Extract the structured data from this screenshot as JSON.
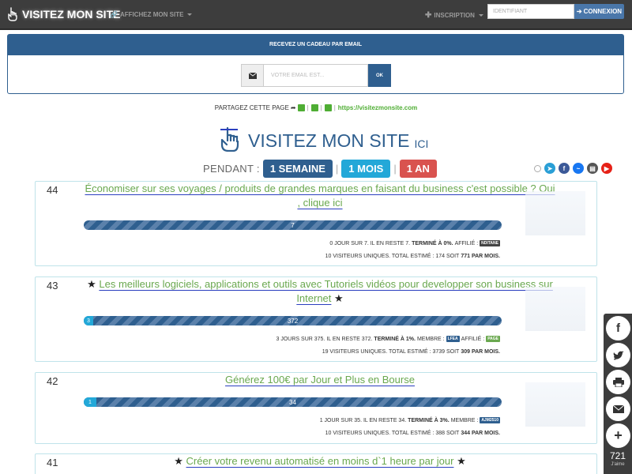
{
  "navbar": {
    "brand": "VISITEZ MON SITE",
    "link_afficher": "AFFICHEZ MON SITE",
    "link_inscription": "INSCRIPTION",
    "login_placeholder": "IDENTIFIANT",
    "login_button": "CONNEXION"
  },
  "gift": {
    "heading": "RECEVEZ UN CADEAU PAR EMAIL",
    "email_placeholder": "VOTRE EMAIL EST...",
    "submit": "OK"
  },
  "share": {
    "label": "PARTAGEZ CETTE PAGE",
    "url": "https://visitezmonsite.com"
  },
  "title": {
    "main": "VISITEZ MON SITE",
    "suffix": "ICI"
  },
  "period": {
    "label": "PENDANT :",
    "week": "1 SEMAINE",
    "month": "1 MOIS",
    "year": "1 AN",
    "separator": "|"
  },
  "items": [
    {
      "num": "44",
      "title": "Économiser sur ses voyages / produits de grandes marques en faisant du business c'est possible ? Oui , clique ici",
      "remaining_label": "7",
      "done_label": "",
      "done_fraction": 0,
      "line1_a": "0 JOUR SUR 7. IL EN RESTE 7.",
      "line1_b": "TERMINÉ À 0%.",
      "line1_c": "AFFILIÉ :",
      "tag1": "NDITANE",
      "line2_a": "10 VISITEURS UNIQUES. TOTAL ESTIMÉ : 174 SOIT",
      "line2_b": "771 PAR MOIS."
    },
    {
      "num": "43",
      "title": "Les meilleurs logiciels, applications et outils avec Tutoriels vidéos pour developper son business sur Internet",
      "remaining_label": "372",
      "done_label": "3",
      "done_fraction": 0.01,
      "line1_a": "3 JOURS SUR 375. IL EN RESTE 372.",
      "line1_b": "TERMINÉ À 1%.",
      "line1_c": "MEMBRE :",
      "tag1": "LFEA",
      "line1_d": "AFFILIÉ :",
      "tag2": "PAGE",
      "line2_a": "19 VISITEURS UNIQUES. TOTAL ESTIMÉ : 3739 SOIT",
      "line2_b": "309 PAR MOIS."
    },
    {
      "num": "42",
      "title": "Générez 100€ par Jour et Plus en Bourse",
      "remaining_label": "34",
      "done_label": "1",
      "done_fraction": 0.03,
      "line1_a": "1 JOUR SUR 35. IL EN RESTE 34.",
      "line1_b": "TERMINÉ À 3%.",
      "line1_c": "MEMBRE :",
      "tag1": "AJM2510",
      "line2_a": "10 VISITEURS UNIQUES. TOTAL ESTIMÉ : 388 SOIT",
      "line2_b": "344 PAR MOIS."
    },
    {
      "num": "41",
      "title": "Créer votre revenu automatisé en moins d`1 heure par jour"
    }
  ],
  "sidebar": {
    "count": "721",
    "label": "J'aime"
  },
  "colors": {
    "navbar": "#3d3d3d",
    "primary": "#2f5f8f",
    "accent_green": "#6aa84f",
    "month_blue": "#23a8d8",
    "year_red": "#d9534f"
  }
}
